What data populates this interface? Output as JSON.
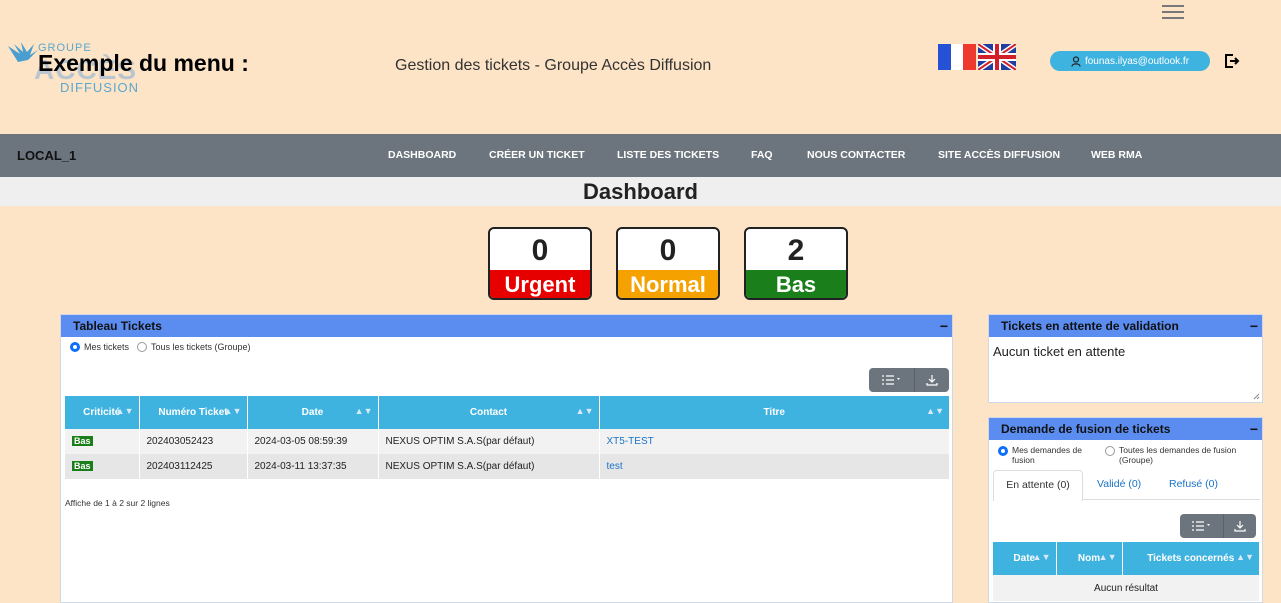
{
  "header": {
    "logo": {
      "line1": "GROUPE",
      "line2": "ACCÈS",
      "line3": "DIFFUSION"
    },
    "menu_title": "Exemple du menu :",
    "app_title": "Gestion des tickets - Groupe Accès Diffusion",
    "user_email": "founas.ilyas@outlook.fr",
    "icons": {
      "menu": "hamburger-icon",
      "flag_fr": "flag-fr-icon",
      "flag_uk": "flag-uk-icon",
      "user": "user-icon",
      "logout": "logout-icon"
    }
  },
  "navbar": {
    "brand": "LOCAL_1",
    "items": [
      "DASHBOARD",
      "CRÉER UN TICKET",
      "LISTE DES TICKETS",
      "FAQ",
      "NOUS CONTACTER",
      "SITE ACCÈS DIFFUSION",
      "WEB RMA"
    ]
  },
  "dashboard": {
    "title": "Dashboard",
    "counters": [
      {
        "value": "0",
        "label": "Urgent",
        "color": "#e60000"
      },
      {
        "value": "0",
        "label": "Normal",
        "color": "#f5a100"
      },
      {
        "value": "2",
        "label": "Bas",
        "color": "#1a7f1a"
      }
    ]
  },
  "tickets_panel": {
    "title": "Tableau Tickets",
    "minimize": "−",
    "filter_mine": "Mes tickets",
    "filter_group": "Tous les tickets (Groupe)",
    "columns": [
      "Criticité",
      "Numéro Ticket",
      "Date",
      "Contact",
      "Titre"
    ],
    "rows": [
      {
        "criticite": "Bas",
        "numero": "202403052423",
        "date": "2024-03-05 08:59:39",
        "contact": "NEXUS OPTIM S.A.S(par défaut)",
        "titre": "XT5-TEST"
      },
      {
        "criticite": "Bas",
        "numero": "202403112425",
        "date": "2024-03-11 13:37:35",
        "contact": "NEXUS OPTIM S.A.S(par défaut)",
        "titre": "test"
      }
    ],
    "footer": "Affiche de 1 à 2 sur 2 lignes"
  },
  "pending_panel": {
    "title": "Tickets en attente de validation",
    "minimize": "−",
    "text": "Aucun ticket en attente"
  },
  "merge_panel": {
    "title": "Demande de fusion de tickets",
    "minimize": "−",
    "filter_mine": "Mes demandes de fusion",
    "filter_group": "Toutes les demandes de fusion (Groupe)",
    "tabs": [
      "En attente (0)",
      "Validé (0)",
      "Refusé (0)"
    ],
    "columns": [
      "Date",
      "Nom",
      "Tickets concernés"
    ],
    "empty": "Aucun résultat"
  }
}
